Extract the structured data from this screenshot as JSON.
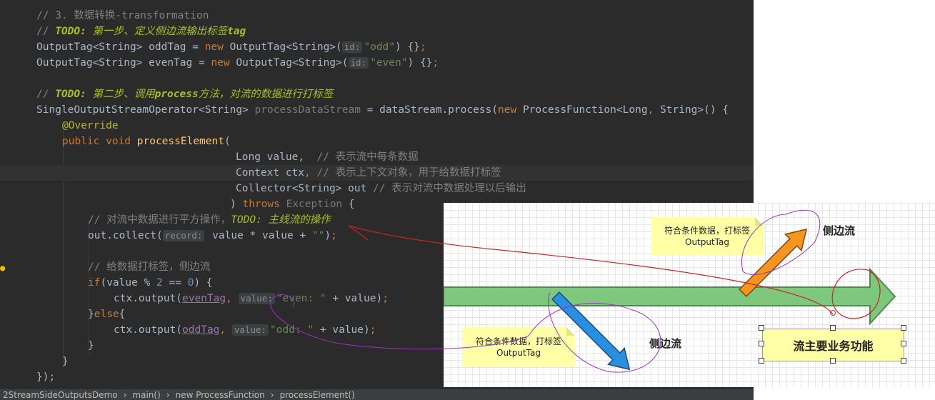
{
  "editor": {
    "lines": {
      "l1_comment": "// 3. 数据转换-transformation",
      "l2_comment_prefix": "// ",
      "l2_todo": "TODO:",
      "l2_text": " 第一步、定义侧边流输出标签",
      "l2_bold": "tag",
      "l3_type": "OutputTag<String> oddTag = ",
      "l3_new": "new",
      "l3_type2": " OutputTag<String>(",
      "l3_hint": "id:",
      "l3_str": "\"odd\"",
      "l3_end": ") {}",
      "l3_semi": ";",
      "l4_type": "OutputTag<String> evenTag = ",
      "l4_new": "new",
      "l4_type2": " OutputTag<String>(",
      "l4_hint": "id:",
      "l4_str": "\"even\"",
      "l4_end": ") {}",
      "l4_semi": ";",
      "l6_comment_prefix": "// ",
      "l6_todo": "TODO:",
      "l6_text1": " 第二步、调用",
      "l6_bold": "process",
      "l6_text2": "方法，对流的数据进行打标签",
      "l7_a": "SingleOutputStreamOperator<String> ",
      "l7_var": "processDataStream",
      "l7_b": " = dataStream.process(",
      "l7_new": "new",
      "l7_c": " ProcessFunction<Long",
      "l7_comma": ",",
      "l7_d": " String>() {",
      "l8_ann": "@Override",
      "l9_pub": "public void",
      "l9_fn": " processElement",
      "l9_paren": "(",
      "l10_code": "Long value,",
      "l10_comment": "  // 表示流中每条数据",
      "l11_code": "Context ctx",
      "l11_comma": ",",
      "l11_comment": " // 表示上下文对象，用于给数据打标签",
      "l12_code": "Collector<String> out",
      "l12_comment": " // 表示对流中数据处理以后输出",
      "l13_paren": ") ",
      "l13_throws": "throws",
      "l13_exc": " Exception",
      "l13_brace": " {",
      "l14_comment": "// 对流中数据进行平方操作，",
      "l14_todo": "TODO: 主线流的操作",
      "l15_a": "out.collect(",
      "l15_hint": "record:",
      "l15_b": " value * value + ",
      "l15_str": "\"\"",
      "l15_c": ")",
      "l15_semi": ";",
      "l17_comment": "// 给数据打标签，侧边流",
      "l18_if": "if",
      "l18_a": "(value % ",
      "l18_n1": "2",
      "l18_b": " == ",
      "l18_n2": "0",
      "l18_c": ") {",
      "l19_a": "ctx.output(",
      "l19_var": "evenTag",
      "l19_comma": ",",
      "l19_hint": "value:",
      "l19_str": "\"even: \"",
      "l19_b": " + value)",
      "l19_semi": ";",
      "l20_a": "}",
      "l20_else": "else",
      "l20_b": "{",
      "l21_a": "ctx.output(",
      "l21_var": "oddTag",
      "l21_comma": ",",
      "l21_hint": "value:",
      "l21_str": "\"odd: \"",
      "l21_b": " + value)",
      "l21_semi": ";",
      "l22": "}",
      "l23": "}",
      "l24": "});"
    }
  },
  "statusbar": {
    "crumb1": "2StreamSideOutputsDemo",
    "crumb2": "main()",
    "crumb3": "new ProcessFunction",
    "crumb4": "processElement()",
    "sep": "›"
  },
  "diagram": {
    "note_top_line1": "符合条件数据，打标签",
    "note_top_line2": "OutputTag",
    "note_bottom_line1": "符合条件数据，打标签",
    "note_bottom_line2": "OutputTag",
    "side_label_top": "侧边流",
    "side_label_bottom": "侧边流",
    "main_box": "流主要业务功能"
  },
  "colors": {
    "main_arrow": "#7ec87e",
    "orange_arrow": "#f7941d",
    "blue_arrow": "#2b8fe0",
    "annotation_red": "#cc2222",
    "annotation_purple": "#a030c0"
  }
}
